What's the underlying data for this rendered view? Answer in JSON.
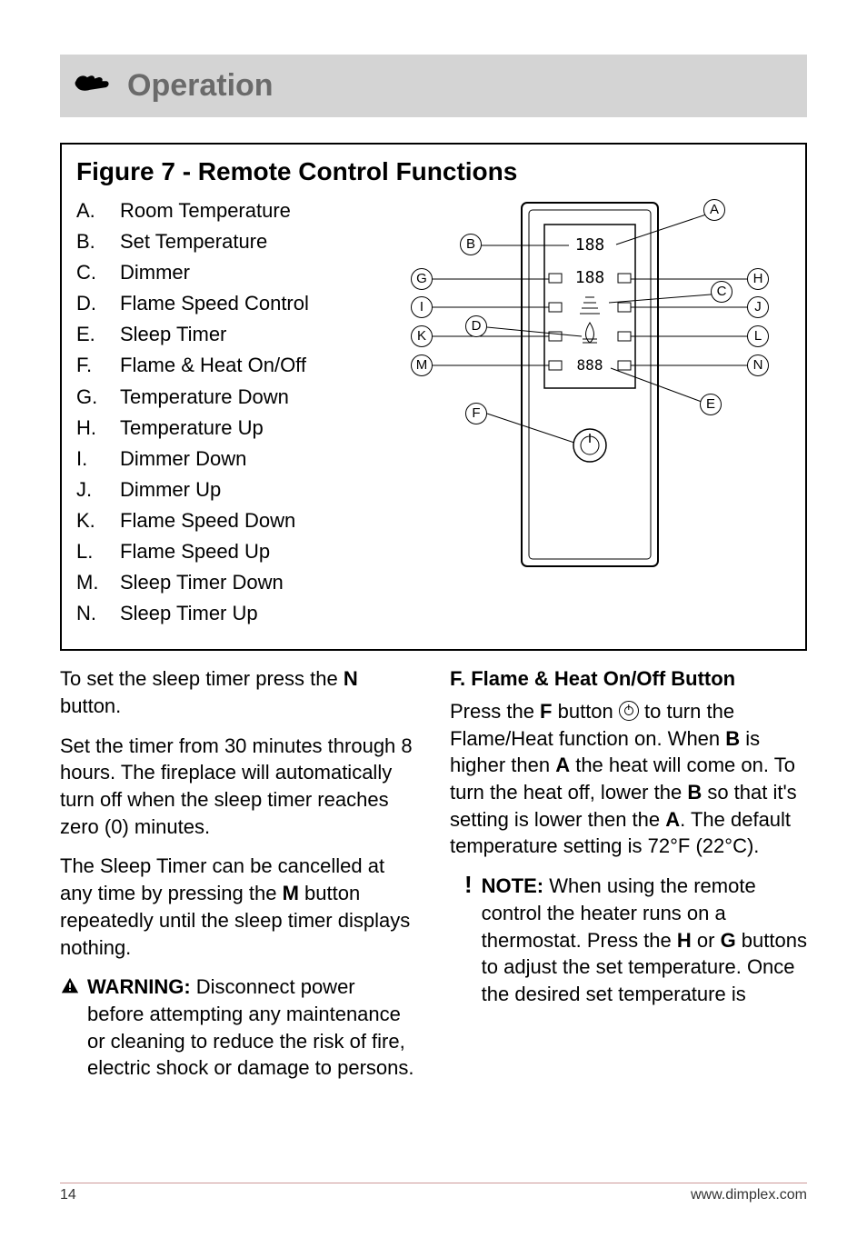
{
  "header": {
    "title": "Operation"
  },
  "figure": {
    "title": "Figure 7 - Remote Control Functions",
    "legend": [
      {
        "letter": "A.",
        "text": "Room Temperature"
      },
      {
        "letter": "B.",
        "text": "Set Temperature"
      },
      {
        "letter": "C.",
        "text": "Dimmer"
      },
      {
        "letter": "D.",
        "text": "Flame Speed Control"
      },
      {
        "letter": "E.",
        "text": "Sleep Timer"
      },
      {
        "letter": "F.",
        "text": "Flame & Heat On/Off"
      },
      {
        "letter": "G.",
        "text": "Temperature Down"
      },
      {
        "letter": "H.",
        "text": "Temperature Up"
      },
      {
        "letter": "I.",
        "text": "Dimmer Down"
      },
      {
        "letter": "J.",
        "text": "Dimmer Up"
      },
      {
        "letter": "K.",
        "text": "Flame Speed Down"
      },
      {
        "letter": "L.",
        "text": "Flame Speed Up"
      },
      {
        "letter": "M.",
        "text": "Sleep Timer Down"
      },
      {
        "letter": "N.",
        "text": "Sleep Timer Up"
      }
    ],
    "callouts": {
      "A": "A",
      "B": "B",
      "C": "C",
      "D": "D",
      "E": "E",
      "F": "F",
      "G": "G",
      "H": "H",
      "I": "I",
      "J": "J",
      "K": "K",
      "L": "L",
      "M": "M",
      "N": "N"
    },
    "lcd": {
      "top": "188",
      "mid": "188",
      "bottom": "888"
    }
  },
  "left": {
    "p1a": "To set the sleep timer press the ",
    "p1b": "N",
    "p1c": " button.",
    "p2": "Set the timer from 30 minutes through 8 hours.  The fireplace will automatically turn off when the sleep timer reaches zero (0) minutes.",
    "p3a": "The Sleep Timer can be cancelled at any time by pressing the ",
    "p3b": "M",
    "p3c": " button repeatedly until the sleep timer displays nothing.",
    "warn_label": "WARNING:",
    "warn_text": "  Disconnect power before attempting any maintenance or cleaning to reduce the risk of fire, electric shock or damage to persons."
  },
  "right": {
    "heading": "F.   Flame & Heat On/Off Button",
    "p1_1": "Press the ",
    "p1_F": "F",
    "p1_2": " button ",
    "p1_3": " to turn the Flame/Heat function on.   When ",
    "p1_B": "B",
    "p1_4": " is higher then ",
    "p1_A": "A",
    "p1_5": " the heat will come on.   To turn the heat off, lower the ",
    "p1_B2": "B",
    "p1_6": " so that it's setting is lower then the ",
    "p1_A2": "A",
    "p1_7": ".   The default temperature setting is 72°F (22°C).",
    "note_label": "NOTE:",
    "note_1": "  When using the remote control the heater runs on a thermostat. Press the ",
    "note_H": "H",
    "note_2": " or ",
    "note_G": "G",
    "note_3": " buttons to adjust the set temperature.   Once the desired set temperature is"
  },
  "footer": {
    "page": "14",
    "url": "www.dimplex.com"
  }
}
